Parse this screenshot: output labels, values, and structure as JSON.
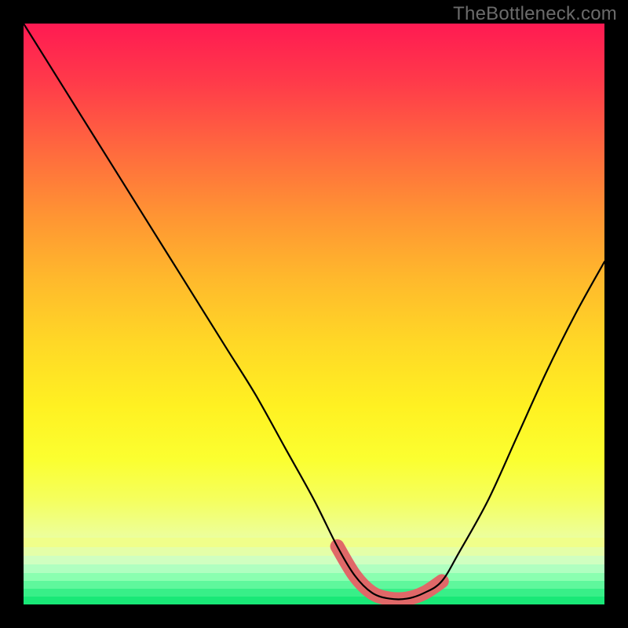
{
  "watermark": "TheBottleneck.com",
  "colors": {
    "background": "#000000",
    "gradient_top": "#ff1a52",
    "gradient_mid": "#ffd826",
    "gradient_bottom": "#19e877",
    "curve": "#000000",
    "valley_marker": "#e06868"
  },
  "chart_data": {
    "type": "line",
    "title": "",
    "xlabel": "",
    "ylabel": "",
    "xlim": [
      0,
      100
    ],
    "ylim": [
      0,
      100
    ],
    "series": [
      {
        "name": "bottleneck-curve",
        "x": [
          0,
          5,
          10,
          15,
          20,
          25,
          30,
          35,
          40,
          45,
          50,
          54,
          57,
          60,
          63,
          66,
          69,
          72,
          75,
          80,
          85,
          90,
          95,
          100
        ],
        "y": [
          100,
          92,
          84,
          76,
          68,
          60,
          52,
          44,
          36,
          27,
          18,
          10,
          5,
          2,
          1,
          1,
          2,
          4,
          9,
          18,
          29,
          40,
          50,
          59
        ]
      }
    ],
    "valley_range_x": [
      54,
      72
    ],
    "annotations": []
  }
}
